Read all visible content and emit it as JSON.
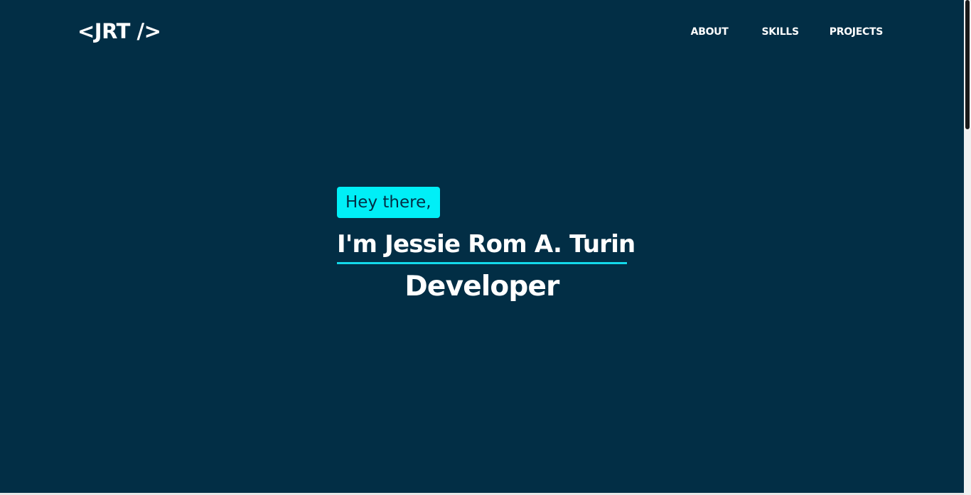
{
  "header": {
    "logo_text": "<JRT />",
    "nav": {
      "about": "ABOUT",
      "skills": "SKILLS",
      "projects": "PROJECTS"
    }
  },
  "hero": {
    "greeting": "Hey there,",
    "name": "I'm Jessie Rom A. Turin",
    "role": "Developer"
  },
  "colors": {
    "background": "#022e45",
    "accent": "#00eff7",
    "text": "#ffffff"
  }
}
